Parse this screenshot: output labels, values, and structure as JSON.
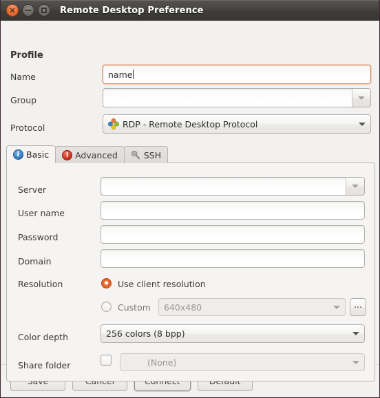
{
  "window": {
    "title": "Remote Desktop Preference",
    "controls": {
      "close": "close-icon",
      "minimize": "minimize-icon",
      "maximize": "maximize-icon"
    }
  },
  "profile": {
    "section_title": "Profile",
    "name_label": "Name",
    "name_value": "name",
    "group_label": "Group",
    "group_value": "",
    "protocol_label": "Protocol",
    "protocol_value": "RDP - Remote Desktop Protocol",
    "protocol_icon": "rdp-icon"
  },
  "tabs": [
    {
      "label": "Basic",
      "icon": "info-icon",
      "active": true
    },
    {
      "label": "Advanced",
      "icon": "alert-icon",
      "active": false
    },
    {
      "label": "SSH",
      "icon": "key-icon",
      "active": false
    }
  ],
  "basic": {
    "server_label": "Server",
    "server_value": "",
    "username_label": "User name",
    "username_value": "",
    "password_label": "Password",
    "password_value": "",
    "domain_label": "Domain",
    "domain_value": "",
    "resolution_label": "Resolution",
    "resolution_client_option": "Use client resolution",
    "resolution_custom_option": "Custom",
    "resolution_custom_value": "640x480",
    "resolution_browse_label": "...",
    "color_depth_label": "Color depth",
    "color_depth_value": "256 colors (8 bpp)",
    "share_folder_label": "Share folder",
    "share_folder_value": "(None)"
  },
  "footer": {
    "save": "Save",
    "cancel": "Cancel",
    "connect": "Connect",
    "default": "Default"
  },
  "colors": {
    "accent_orange": "#dd5c22",
    "window_border": "#3b2330",
    "titlebar": "#454340",
    "panel_bg": "#f5f4f3",
    "body_bg": "#f2f1f0"
  }
}
